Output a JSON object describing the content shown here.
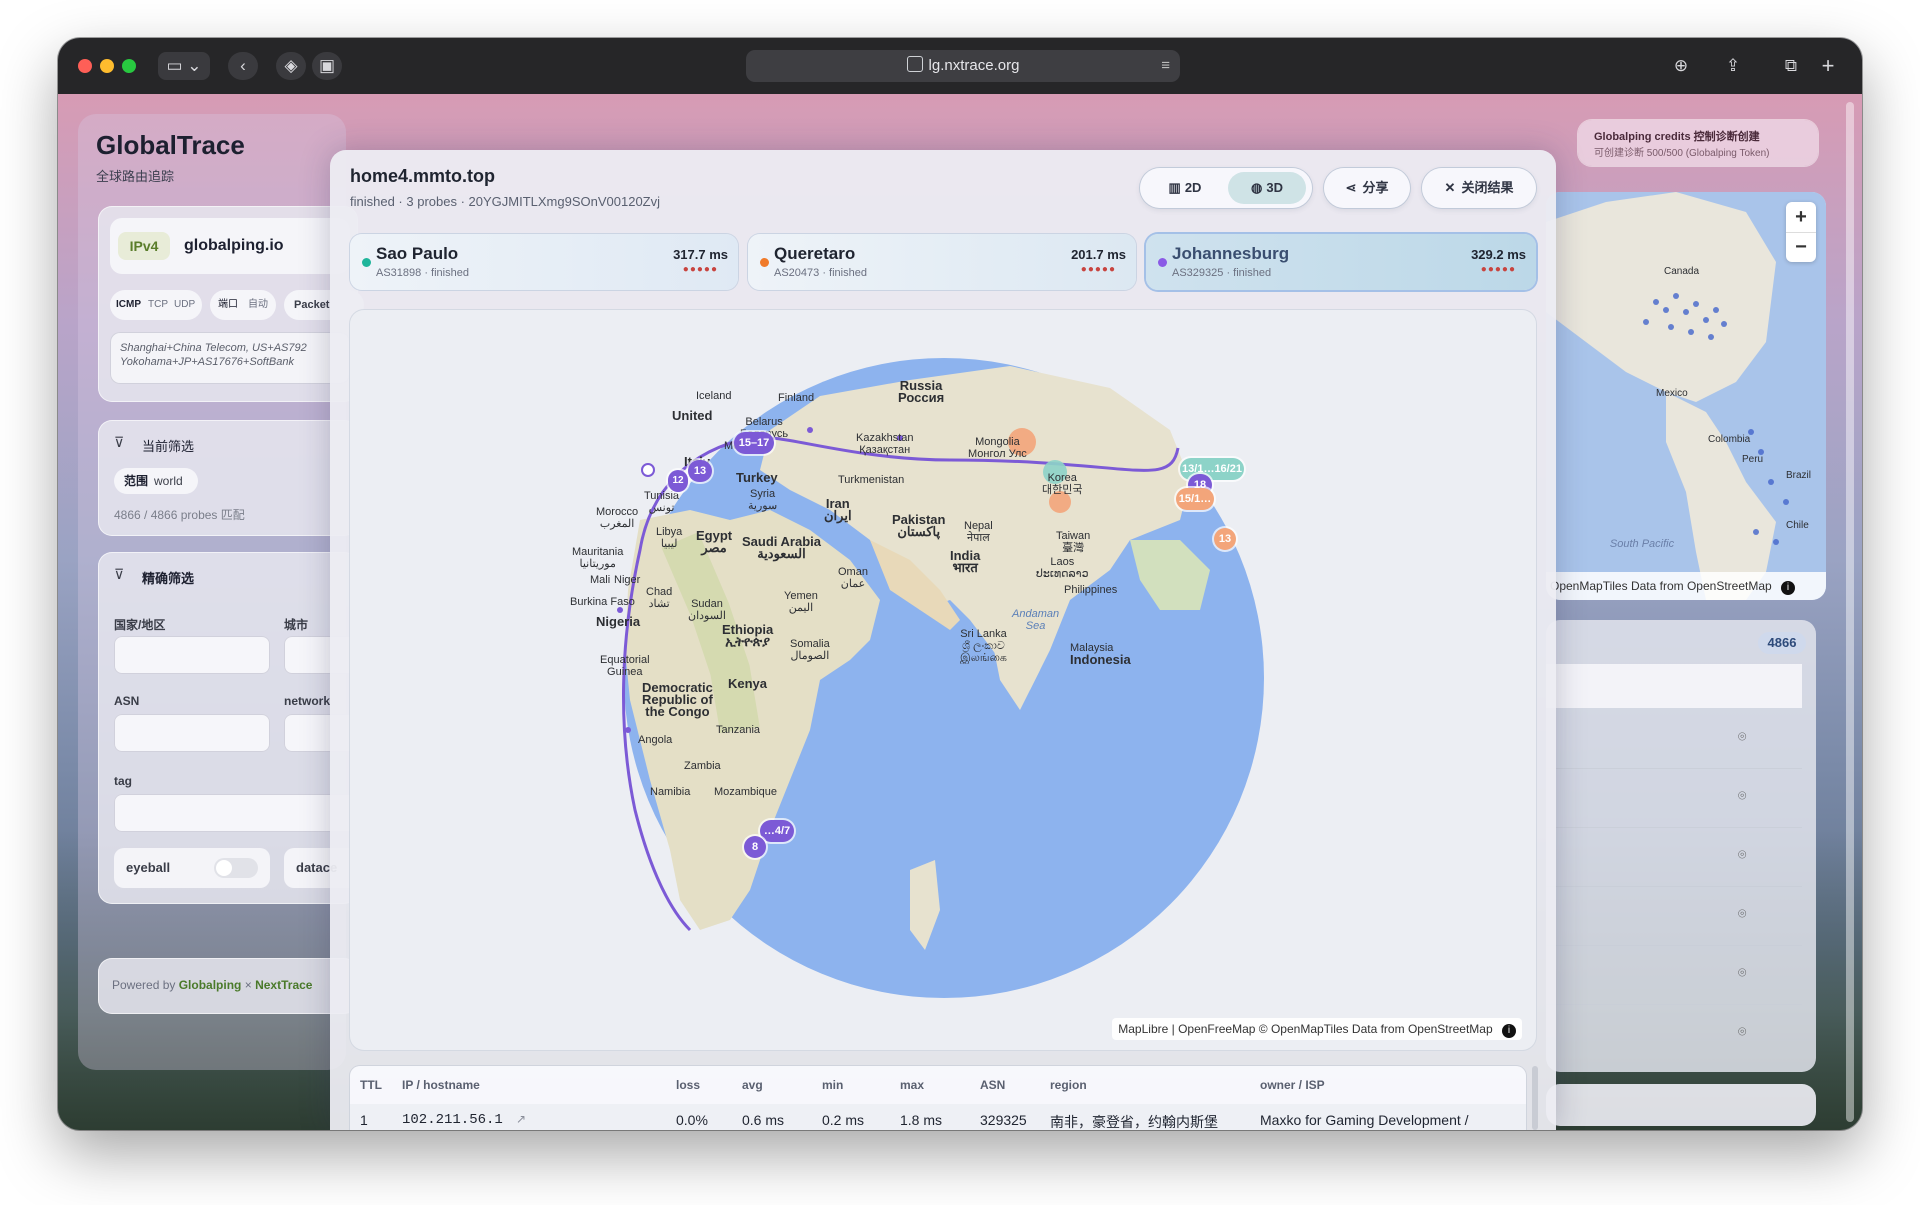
{
  "browser": {
    "url": "lg.nxtrace.org"
  },
  "sidebar": {
    "app_title": "GlobalTrace",
    "app_subtitle": "全球路由追踪",
    "ip_version": "IPv4",
    "provider": "globalping.io",
    "protocols": [
      "ICMP",
      "TCP",
      "UDP"
    ],
    "port_label": "端口",
    "port_value": "自动",
    "packets_label": "Packet",
    "targets_text_line1": "Shanghai+China Telecom, US+AS792",
    "targets_text_line2": "Yokohama+JP+AS17676+SoftBank",
    "current_filter_title": "当前筛选",
    "scope_label": "范围",
    "scope_value": "world",
    "probe_count_text": "4866 / 4866 probes 匹配",
    "precise_filter_title": "精确筛选",
    "country_label": "国家/地区",
    "city_label": "城市",
    "asn_label": "ASN",
    "network_label": "network",
    "tag_label": "tag",
    "eyeball_label": "eyeball",
    "datacenter_label": "datace",
    "powered_by_prefix": "Powered by",
    "powered_by_globalping": "Globalping",
    "powered_by_sep": "×",
    "powered_by_nexttrace": "NextTrace"
  },
  "right_panel": {
    "credits_title": "Globalping credits 控制诊断创建",
    "credits_sub": "可创建诊断 500/500 (Globalping Token)",
    "map_attribution_1": "OpenMapTiles",
    "map_attribution_2": "Data from",
    "map_attribution_3": "OpenStreetMap",
    "labels": {
      "canada": "Canada",
      "mexico": "Mexico",
      "colombia": "Colombia",
      "peru": "Peru",
      "brazil": "Brazil",
      "chile": "Chile",
      "south_pacific": "South Pacific"
    },
    "count_badge": "4866",
    "zoom_in": "+",
    "zoom_out": "−"
  },
  "result": {
    "target": "home4.mmto.top",
    "status": "finished",
    "probes_text": "3 probes",
    "measurement_id": "20YGJMITLXmg9SOnV00120Zvj",
    "view_2d": "2D",
    "view_3d": "3D",
    "share": "分享",
    "close": "关闭结果",
    "probes": [
      {
        "city": "Sao Paulo",
        "asn": "AS31898",
        "status": "finished",
        "latency": "317.7 ms",
        "color": "#1fb59b"
      },
      {
        "city": "Queretaro",
        "asn": "AS20473",
        "status": "finished",
        "latency": "201.7 ms",
        "color": "#f07a2a"
      },
      {
        "city": "Johannesburg",
        "asn": "AS329325",
        "status": "finished",
        "latency": "329.2 ms",
        "color": "#8a5ae6"
      }
    ],
    "map_attribution": "MapLibre | OpenFreeMap © OpenMapTiles",
    "map_attribution_data": "Data from",
    "map_attribution_osm": "OpenStreetMap",
    "map_labels": {
      "iceland": "Iceland",
      "finland": "Finland",
      "russia": "Russia\nРоссия",
      "united": "United",
      "belarus": "Belarus\nБеларусь",
      "kazakhstan": "Kazakhstan\nҚазақстан",
      "mongolia": "Mongolia\nМонгол Улс",
      "moldova": "Moldova",
      "italy": "Italy",
      "turkey": "Turkey",
      "turkmenistan": "Turkmenistan",
      "korea": "Korea\n대한민국",
      "tunisia": "Tunisia\nتونس",
      "morocco": "Morocco\nالمغرب",
      "syria": "Syria\nسورية",
      "iran": "Iran\nایران",
      "pakistan": "Pakistan\nپاکستان",
      "nepal": "Nepal\nनेपाल",
      "taiwan": "Taiwan\n臺灣",
      "libya": "Libya\nليبيا",
      "egypt": "Egypt\nمصر",
      "saudi": "Saudi Arabia\nالسعودية",
      "india": "India\nभारत",
      "laos": "Laos\nປະເທດລາວ",
      "mauritania": "Mauritania\nموريتانيا",
      "oman": "Oman\nعمان",
      "philippines": "Philippines",
      "mali": "Mali",
      "niger": "Niger",
      "chad": "Chad\nتشاد",
      "burkina": "Burkina Faso",
      "sudan": "Sudan\nالسودان",
      "yemen": "Yemen\nاليمن",
      "andaman": "Andaman\nSea",
      "nigeria": "Nigeria",
      "ethiopia": "Ethiopia\nኢትዮጵያ",
      "somalia": "Somalia\nالصومال",
      "srilanka": "Sri Lanka\nශ්‍රී ලංකාව\nஇலங்கை",
      "malaysia": "Malaysia",
      "eqguinea": "Equatorial\nGuinea",
      "drc": "Democratic\nRepublic of\nthe Congo",
      "kenya": "Kenya",
      "indonesia": "Indonesia",
      "tanzania": "Tanzania",
      "angola": "Angola",
      "zambia": "Zambia",
      "namibia": "Namibia",
      "mozambique": "Mozambique"
    },
    "hop_badges": [
      "15–17",
      "13",
      "12",
      "13/1…16/21",
      "18",
      "15/1…",
      "13",
      "…4/7",
      "8"
    ],
    "table": {
      "headers": [
        "TTL",
        "IP / hostname",
        "loss",
        "avg",
        "min",
        "max",
        "ASN",
        "region",
        "owner / ISP"
      ],
      "rows": [
        {
          "ttl": "1",
          "ip": "102.211.56.1",
          "loss": "0.0%",
          "avg": "0.6 ms",
          "min": "0.2 ms",
          "max": "1.8 ms",
          "asn": "329325",
          "region": "南非，豪登省，约翰内斯堡",
          "owner": "Maxko for Gaming Development /"
        }
      ]
    }
  }
}
